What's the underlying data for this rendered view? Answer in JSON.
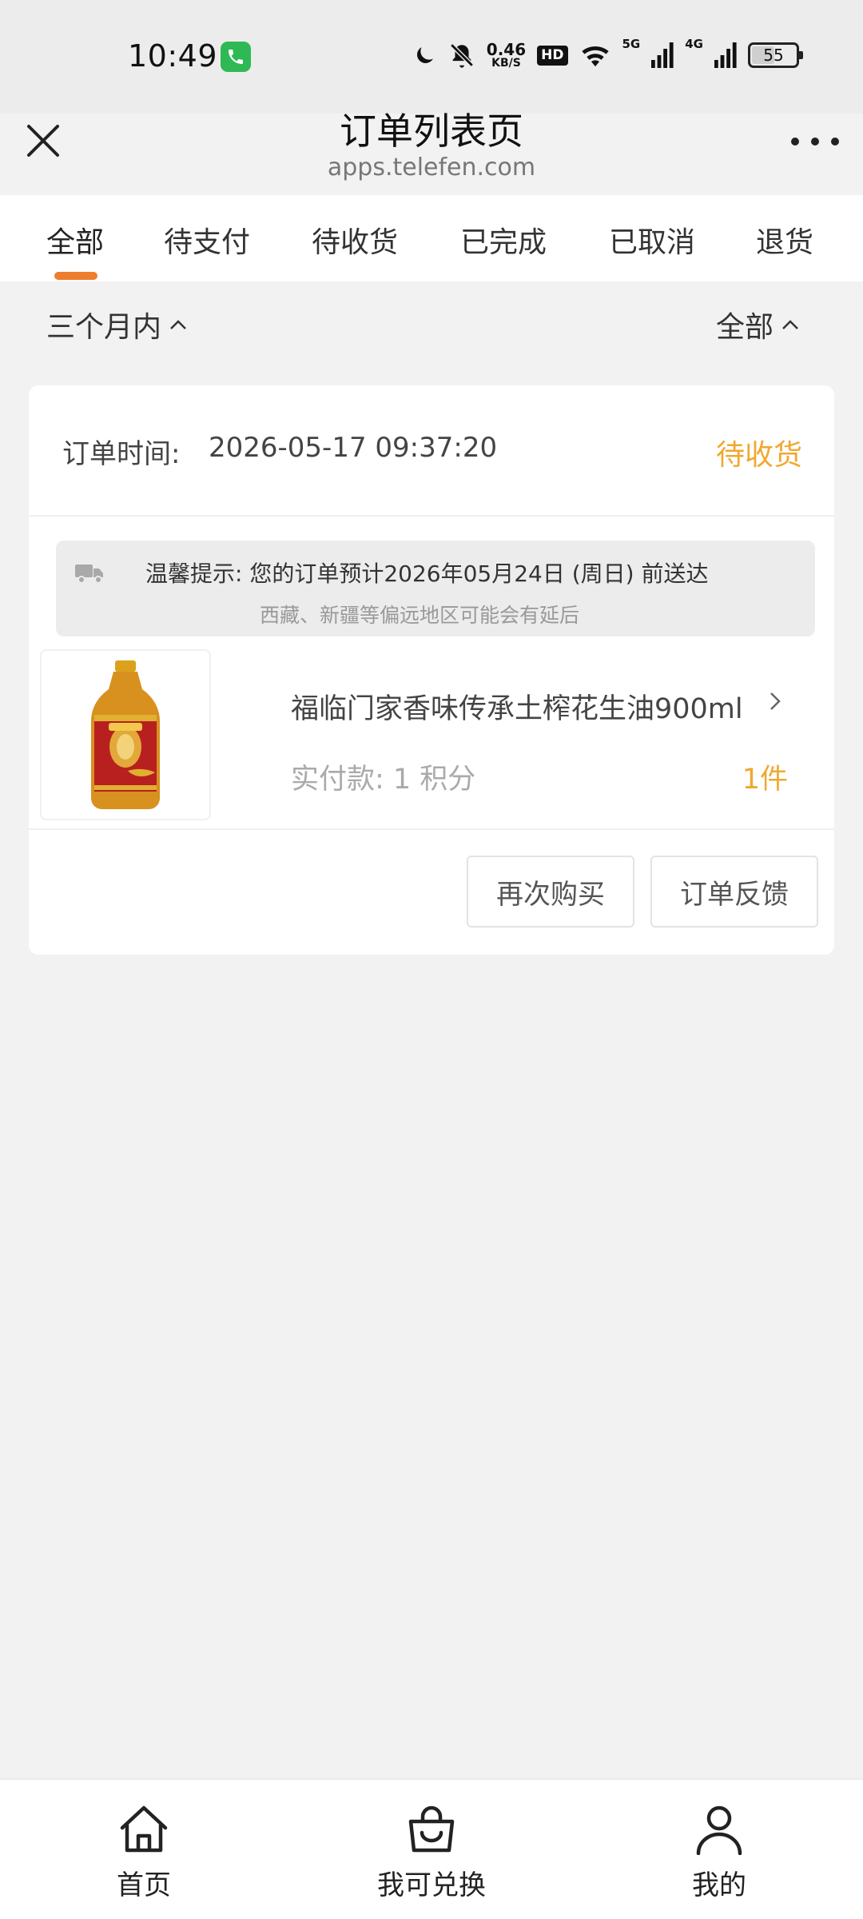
{
  "status_bar": {
    "time": "10:49",
    "net_speed_value": "0.46",
    "net_speed_unit": "KB/S",
    "hd_label": "HD",
    "signal_1_label": "5G",
    "signal_2_label": "4G",
    "battery": "55"
  },
  "header": {
    "title": "订单列表页",
    "url": "apps.telefen.com"
  },
  "tabs": [
    {
      "label": "全部",
      "active": true
    },
    {
      "label": "待支付",
      "active": false
    },
    {
      "label": "待收货",
      "active": false
    },
    {
      "label": "已完成",
      "active": false
    },
    {
      "label": "已取消",
      "active": false
    },
    {
      "label": "退货",
      "active": false
    }
  ],
  "filters": {
    "time_range": "三个月内",
    "category": "全部"
  },
  "order": {
    "time_label": "订单时间:",
    "time_value": "2026-05-17 09:37:20",
    "status": "待收货",
    "notice_line1": "温馨提示:  您的订单预计2026年05月24日 (周日) 前送达",
    "notice_line2": "西藏、新疆等偏远地区可能会有延后",
    "product_name": "福临门家香味传承土榨花生油900ml",
    "price": "实付款: 1 积分",
    "quantity": "1件",
    "rebuy_label": "再次购买",
    "feedback_label": "订单反馈"
  },
  "bottom_nav": [
    {
      "label": "首页",
      "icon": "home-icon"
    },
    {
      "label": "我可兑换",
      "icon": "shopping-bag-icon"
    },
    {
      "label": "我的",
      "icon": "user-icon"
    }
  ],
  "colors": {
    "accent_orange": "#ee7d2d",
    "status_yellow": "#f0a830",
    "call_green": "#2fb955"
  }
}
